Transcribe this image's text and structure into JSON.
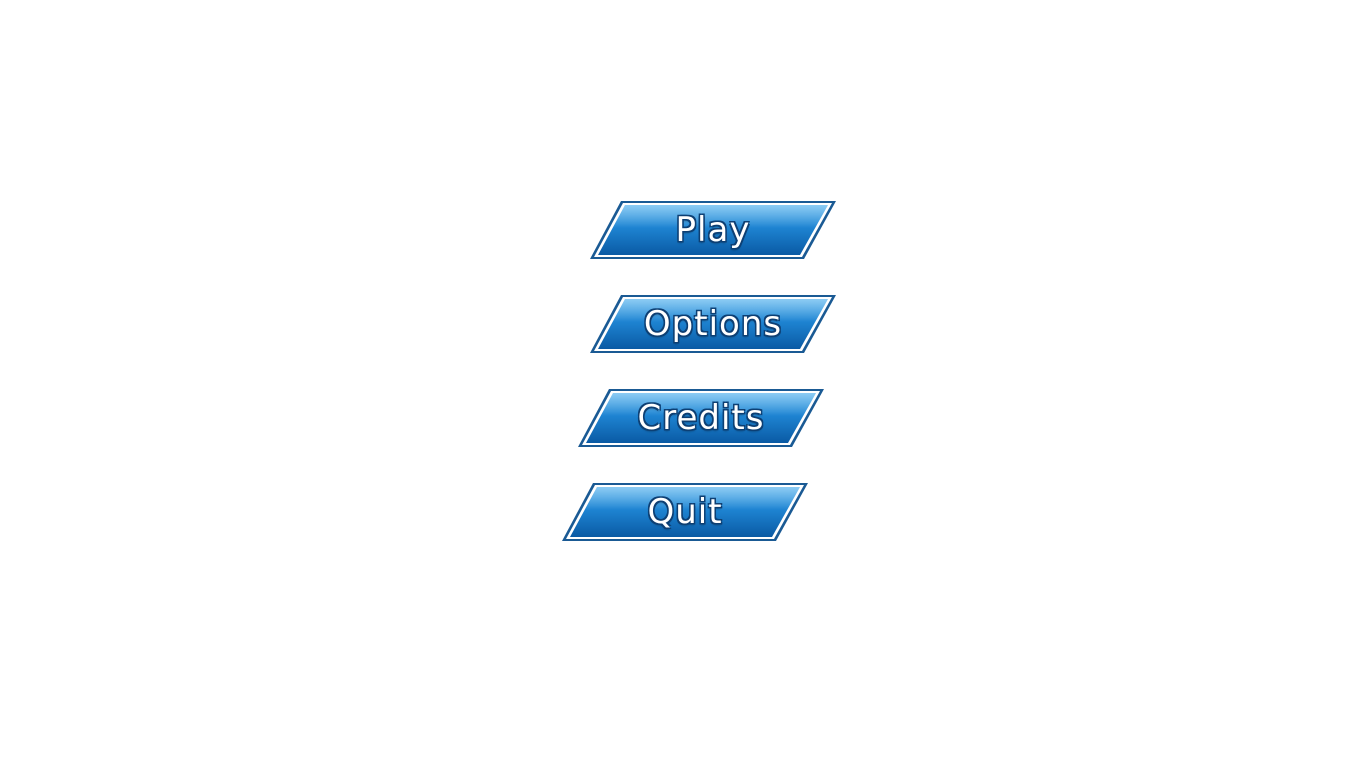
{
  "menu": {
    "items": [
      {
        "label": "Play"
      },
      {
        "label": "Options"
      },
      {
        "label": "Credits"
      },
      {
        "label": "Quit"
      }
    ]
  },
  "colors": {
    "button_top": "#3aa0e4",
    "button_bottom": "#0a62b0",
    "button_border": "#1a5a94",
    "button_inner_border": "#ffffff",
    "background": "#ffffff"
  }
}
